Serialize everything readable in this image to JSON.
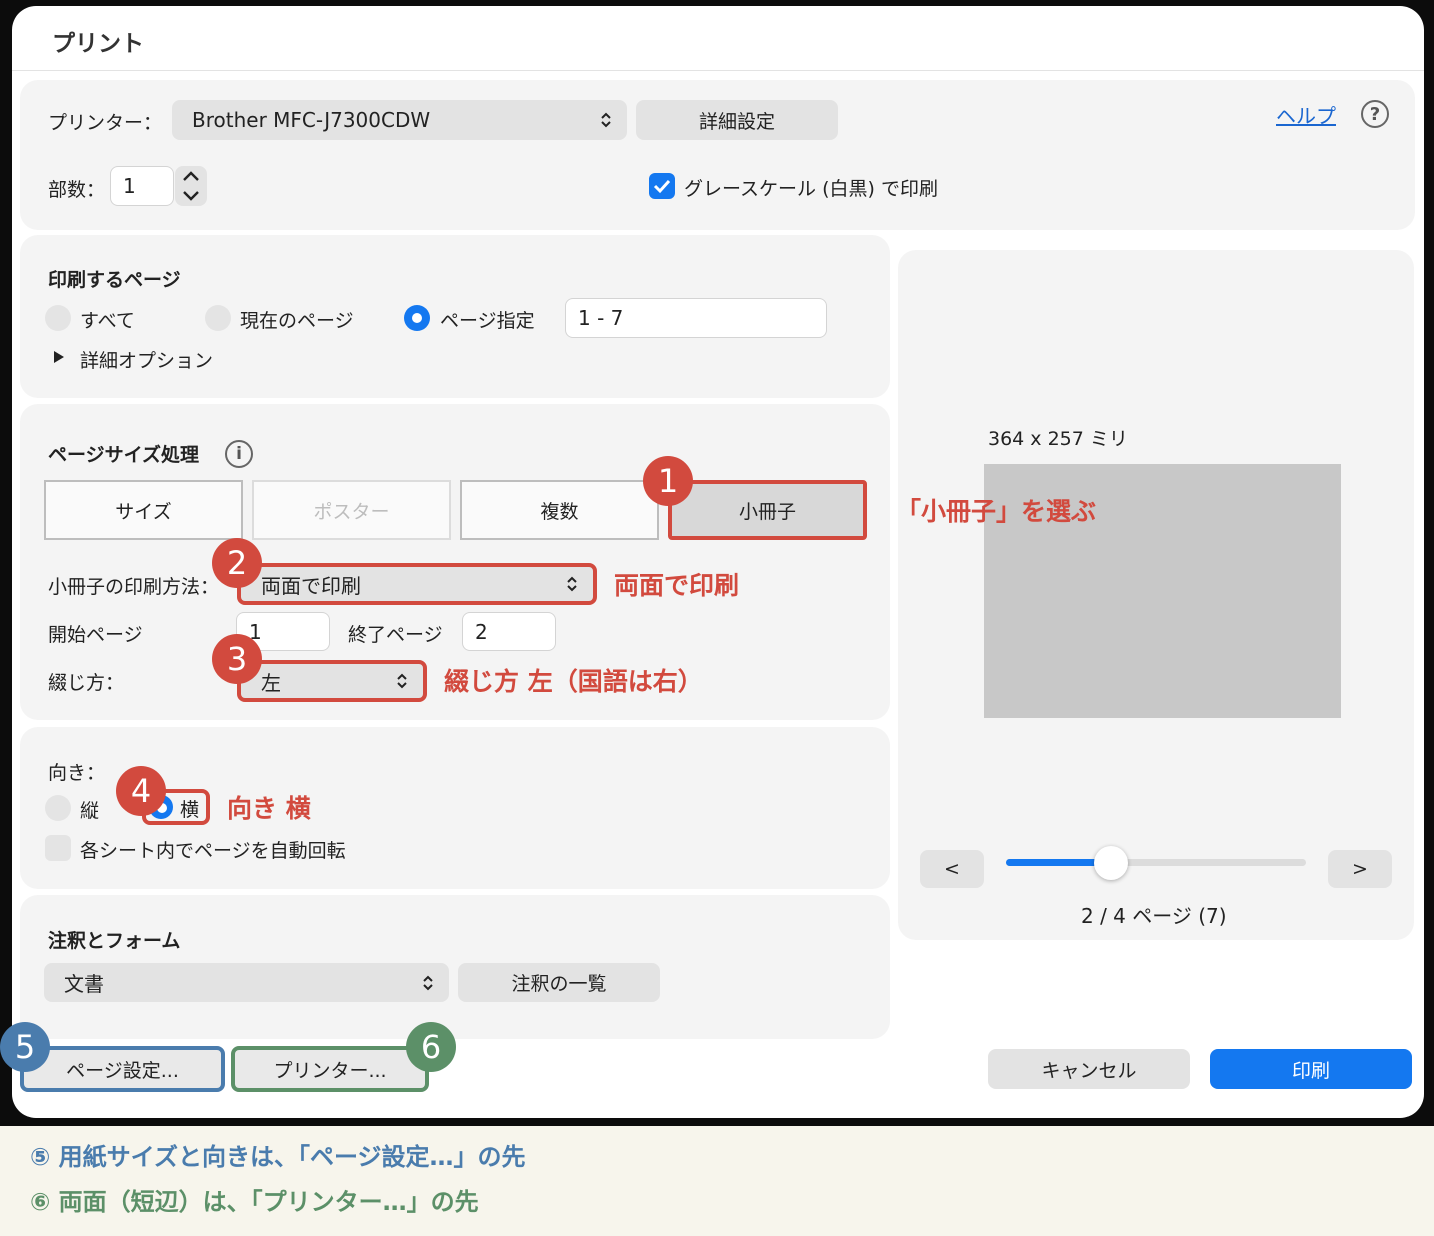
{
  "dialog": {
    "title": "プリント"
  },
  "printer": {
    "label": "プリンター：",
    "selected": "Brother MFC-J7300CDW",
    "details_button": "詳細設定",
    "help_link": "ヘルプ",
    "help_icon": "?"
  },
  "copies": {
    "label": "部数：",
    "value": "1"
  },
  "grayscale": {
    "label": "グレースケール (白黒) で印刷",
    "checked": true
  },
  "pages": {
    "heading": "印刷するページ",
    "options": [
      "すべて",
      "現在のページ",
      "ページ指定"
    ],
    "selected_index": 2,
    "range_value": "1 - 7",
    "more_options": "詳細オプション"
  },
  "page_size": {
    "heading": "ページサイズ処理",
    "info_icon": "i",
    "segments": [
      "サイズ",
      "ポスター",
      "複数",
      "小冊子"
    ],
    "selected_segment": "小冊子",
    "booklet_method_label": "小冊子の印刷方法：",
    "booklet_method_value": "両面で印刷",
    "start_page_label": "開始ページ",
    "start_page_value": "1",
    "end_page_label": "終了ページ",
    "end_page_value": "2",
    "binding_label": "綴じ方：",
    "binding_value": "左"
  },
  "orientation": {
    "label": "向き：",
    "portrait": "縦",
    "landscape": "横",
    "selected": "横",
    "auto_rotate": "各シート内でページを自動回転"
  },
  "annotations": {
    "heading": "注釈とフォーム",
    "select_value": "文書",
    "list_button": "注釈の一覧"
  },
  "preview": {
    "dimensions": "364 x 257 ミリ",
    "prev_button": "<",
    "next_button": ">",
    "page_indicator": "2 / 4 ページ (7)",
    "slider_fraction": 0.35
  },
  "footer": {
    "page_setup_button": "ページ設定...",
    "printer_button": "プリンター...",
    "cancel_button": "キャンセル",
    "print_button": "印刷"
  },
  "overlays": {
    "badges": [
      "1",
      "2",
      "3",
      "4",
      "5",
      "6"
    ],
    "note_booklet": "「小冊子」を選ぶ",
    "note_duplex": "両面で印刷",
    "note_binding": "綴じ方 左（国語は右）",
    "note_orientation": "向き 横",
    "caption_5": "⑤ 用紙サイズと向きは、「ページ設定…」の先",
    "caption_6": "⑥ 両面（短辺）は、「プリンター…」の先"
  },
  "colors": {
    "accent_blue": "#1478f0",
    "annotation_red": "#d24a3e",
    "annotation_blue": "#4a7cad",
    "annotation_green": "#5c9068"
  }
}
